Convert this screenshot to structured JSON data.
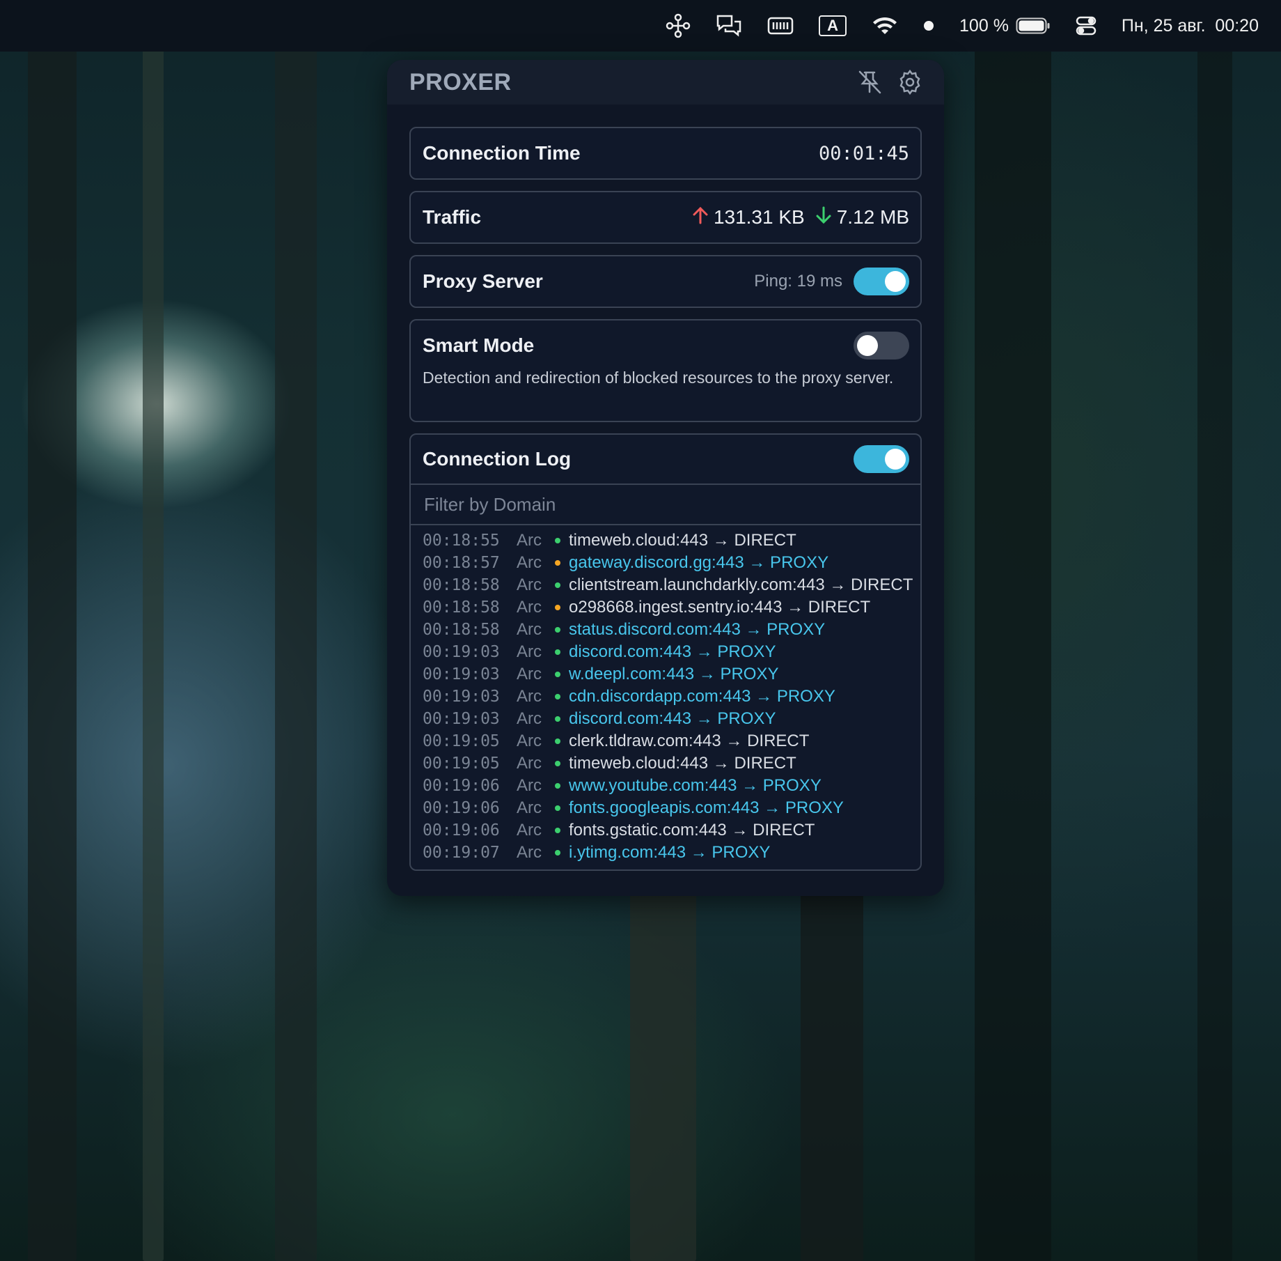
{
  "menubar": {
    "battery_percent": "100 %",
    "datetime": "Пн, 25 авг.  00:20",
    "input_source": "A",
    "icons": [
      "network-nodes-icon",
      "chat-bubbles-icon",
      "keyboard-memory-icon",
      "input-source-icon",
      "wifi-icon",
      "record-dot-icon",
      "battery-icon",
      "control-center-icon"
    ]
  },
  "app": {
    "title": "PROXER",
    "header_icons": [
      "unpin-icon",
      "settings-gear-icon"
    ]
  },
  "connection_time": {
    "label": "Connection Time",
    "value": "00:01:45"
  },
  "traffic": {
    "label": "Traffic",
    "upload": "131.31 KB",
    "download": "7.12 MB",
    "upload_color": "#f05a5a",
    "download_color": "#3ccf6e"
  },
  "proxy_server": {
    "label": "Proxy Server",
    "ping": "Ping: 19 ms",
    "enabled": true
  },
  "smart_mode": {
    "label": "Smart Mode",
    "description": "Detection and redirection of blocked resources to the proxy server.",
    "enabled": false
  },
  "connection_log": {
    "label": "Connection Log",
    "enabled": true,
    "filter_placeholder": "Filter by Domain",
    "entries": [
      {
        "time": "00:18:55",
        "app": "Arc",
        "dot": "#3ccf6e",
        "text": "timeweb.cloud:443 → DIRECT",
        "route": "direct"
      },
      {
        "time": "00:18:57",
        "app": "Arc",
        "dot": "#f5a623",
        "text": "gateway.discord.gg:443 → PROXY",
        "route": "proxy"
      },
      {
        "time": "00:18:58",
        "app": "Arc",
        "dot": "#3ccf6e",
        "text": "clientstream.launchdarkly.com:443 → DIRECT",
        "route": "direct"
      },
      {
        "time": "00:18:58",
        "app": "Arc",
        "dot": "#f5a623",
        "text": "o298668.ingest.sentry.io:443 → DIRECT",
        "route": "direct"
      },
      {
        "time": "00:18:58",
        "app": "Arc",
        "dot": "#3ccf6e",
        "text": "status.discord.com:443 → PROXY",
        "route": "proxy"
      },
      {
        "time": "00:19:03",
        "app": "Arc",
        "dot": "#3ccf6e",
        "text": "discord.com:443 → PROXY",
        "route": "proxy"
      },
      {
        "time": "00:19:03",
        "app": "Arc",
        "dot": "#3ccf6e",
        "text": "w.deepl.com:443 → PROXY",
        "route": "proxy"
      },
      {
        "time": "00:19:03",
        "app": "Arc",
        "dot": "#3ccf6e",
        "text": "cdn.discordapp.com:443 → PROXY",
        "route": "proxy"
      },
      {
        "time": "00:19:03",
        "app": "Arc",
        "dot": "#3ccf6e",
        "text": "discord.com:443 → PROXY",
        "route": "proxy"
      },
      {
        "time": "00:19:05",
        "app": "Arc",
        "dot": "#3ccf6e",
        "text": "clerk.tldraw.com:443 → DIRECT",
        "route": "direct"
      },
      {
        "time": "00:19:05",
        "app": "Arc",
        "dot": "#3ccf6e",
        "text": "timeweb.cloud:443 → DIRECT",
        "route": "direct"
      },
      {
        "time": "00:19:06",
        "app": "Arc",
        "dot": "#3ccf6e",
        "text": "www.youtube.com:443 → PROXY",
        "route": "proxy"
      },
      {
        "time": "00:19:06",
        "app": "Arc",
        "dot": "#3ccf6e",
        "text": "fonts.googleapis.com:443 → PROXY",
        "route": "proxy"
      },
      {
        "time": "00:19:06",
        "app": "Arc",
        "dot": "#3ccf6e",
        "text": "fonts.gstatic.com:443 → DIRECT",
        "route": "direct"
      },
      {
        "time": "00:19:07",
        "app": "Arc",
        "dot": "#3ccf6e",
        "text": "i.ytimg.com:443 → PROXY",
        "route": "proxy"
      }
    ]
  }
}
